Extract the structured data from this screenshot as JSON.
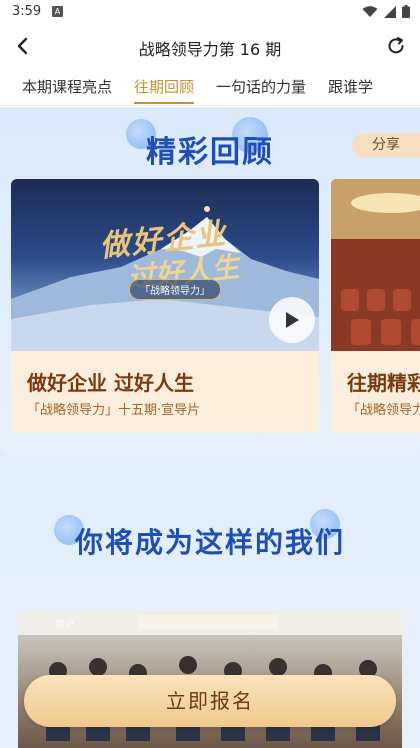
{
  "status": {
    "time": "3:59",
    "indicator": "A"
  },
  "header": {
    "title": "战略领导力第 16 期"
  },
  "tabs": [
    {
      "label": "本期课程亮点",
      "active": false
    },
    {
      "label": "往期回顾",
      "active": true
    },
    {
      "label": "一句话的力量",
      "active": false
    },
    {
      "label": "跟谁学",
      "active": false
    }
  ],
  "review": {
    "title": "精彩回顾",
    "share_label": "分享",
    "cards": [
      {
        "title": "做好企业 过好人生",
        "subtitle": "「战略领导力」十五期·宣导片",
        "promo_line1": "做好企业",
        "promo_line2": "过好人生",
        "promo_tag": "「战略领导力」"
      },
      {
        "title": "往期精彩",
        "subtitle": "「战略领导力」"
      }
    ]
  },
  "section2": {
    "title": "你将成为这样的我们",
    "watermark": "智识"
  },
  "cta": {
    "label": "立即报名"
  },
  "colors": {
    "accent": "#c8912f",
    "title_blue": "#1f4fb5",
    "cta_bg": "#f0c98c"
  }
}
